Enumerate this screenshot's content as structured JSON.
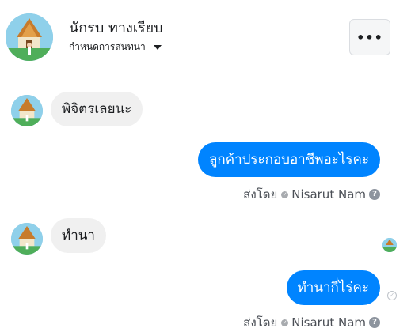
{
  "header": {
    "name": "นักรบ ทางเรียบ",
    "subtitle": "กำหนดการสนทนา",
    "more_label": "•••"
  },
  "messages": [
    {
      "direction": "in",
      "text": "พิจิตรเลยนะ"
    },
    {
      "direction": "out",
      "text": "ลูกค้าประกอบอาชีพอะไรคะ",
      "sent_by_label": "ส่งโดย",
      "sender": "Nisarut Nam"
    },
    {
      "direction": "in",
      "text": "ทำนา"
    },
    {
      "direction": "out",
      "text": "ทำนากี่ไร่คะ",
      "sent_by_label": "ส่งโดย",
      "sender": "Nisarut Nam"
    }
  ],
  "colors": {
    "outgoing": "#0084ff",
    "incoming": "#f0f0f0"
  },
  "icons": {
    "more": "more-dots-icon",
    "caret": "caret-down-icon",
    "help": "help-icon",
    "sent": "sent-check-icon"
  }
}
